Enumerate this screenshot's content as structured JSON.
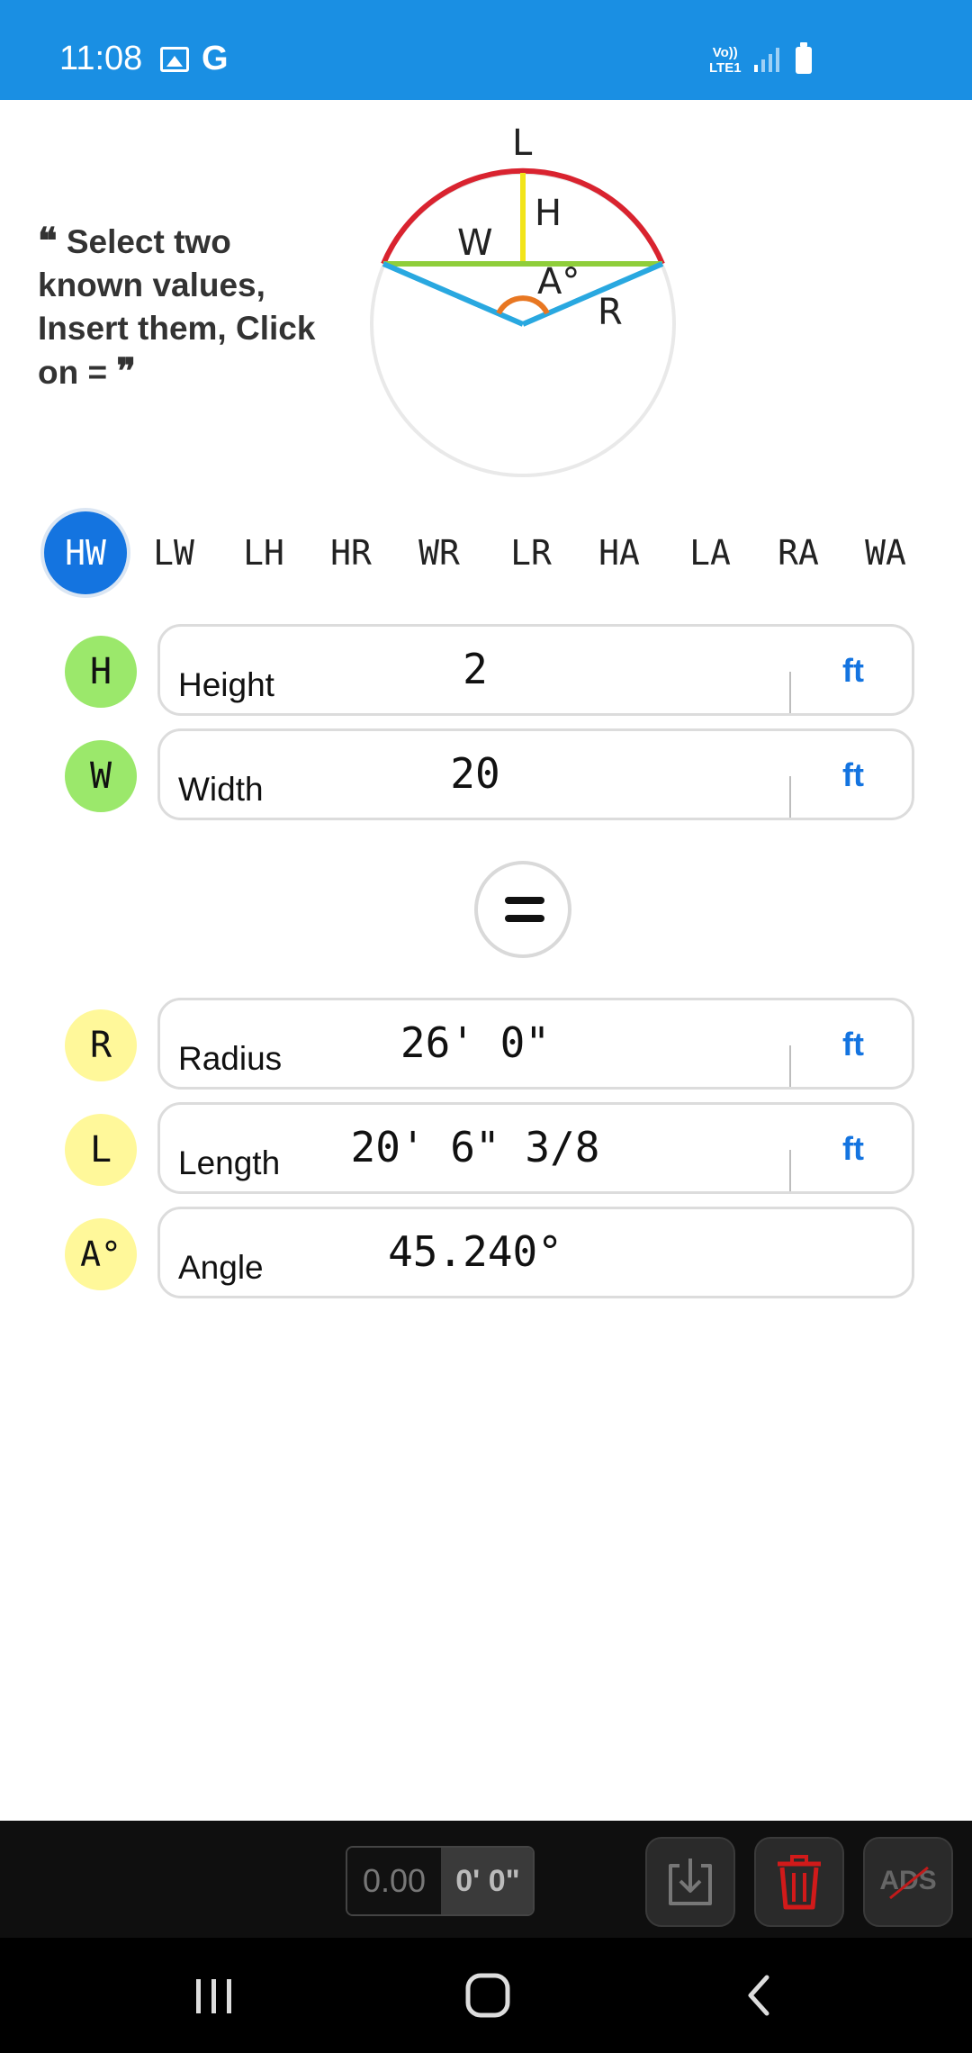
{
  "status_bar": {
    "time": "11:08",
    "google_letter": "G",
    "network_line1": "Vo))",
    "network_line2": "LTE1",
    "icons": [
      "gallery-icon",
      "google-icon",
      "volte-icon",
      "signal-icon",
      "battery-icon"
    ]
  },
  "hint": {
    "open_quote": "❝",
    "text": "Select two known values, Insert them, Click on =",
    "close_quote": "❞"
  },
  "diagram": {
    "labels": {
      "length": "L",
      "height": "H",
      "width": "W",
      "angle": "A°",
      "radius": "R"
    },
    "colors": {
      "arc": "#d9232f",
      "height": "#f2e41a",
      "chord": "#8fce3a",
      "radius": "#29a8e0",
      "angle": "#e87722",
      "circle": "#e9e9e9"
    }
  },
  "modes": {
    "items": [
      "HW",
      "LW",
      "LH",
      "HR",
      "WR",
      "LR",
      "HA",
      "LA",
      "RA",
      "WA"
    ],
    "selected": "HW"
  },
  "inputs": [
    {
      "badge": "H",
      "label": "Height",
      "value": "2",
      "unit": "ft"
    },
    {
      "badge": "W",
      "label": "Width",
      "value": "20",
      "unit": "ft"
    }
  ],
  "equals": {
    "icon": "equals-icon"
  },
  "results": [
    {
      "badge": "R",
      "label": "Radius",
      "value": "26' 0\"",
      "unit": "ft"
    },
    {
      "badge": "L",
      "label": "Length",
      "value": "20' 6\" 3/8",
      "unit": "ft"
    },
    {
      "badge": "A°",
      "label": "Angle",
      "value": "45.240°"
    }
  ],
  "toolbar": {
    "decimal_value": "0.00",
    "feet_value": "0' 0\"",
    "ads_label": "ADS",
    "icons": [
      "save-icon",
      "trash-icon",
      "no-ads-icon"
    ]
  },
  "nav": {
    "icons": [
      "recents-icon",
      "home-icon",
      "back-icon"
    ]
  },
  "colors": {
    "accent": "#1474e0",
    "status_bar": "#1a8fe3",
    "input_badge": "#9be86b",
    "result_badge": "#fff89a"
  }
}
